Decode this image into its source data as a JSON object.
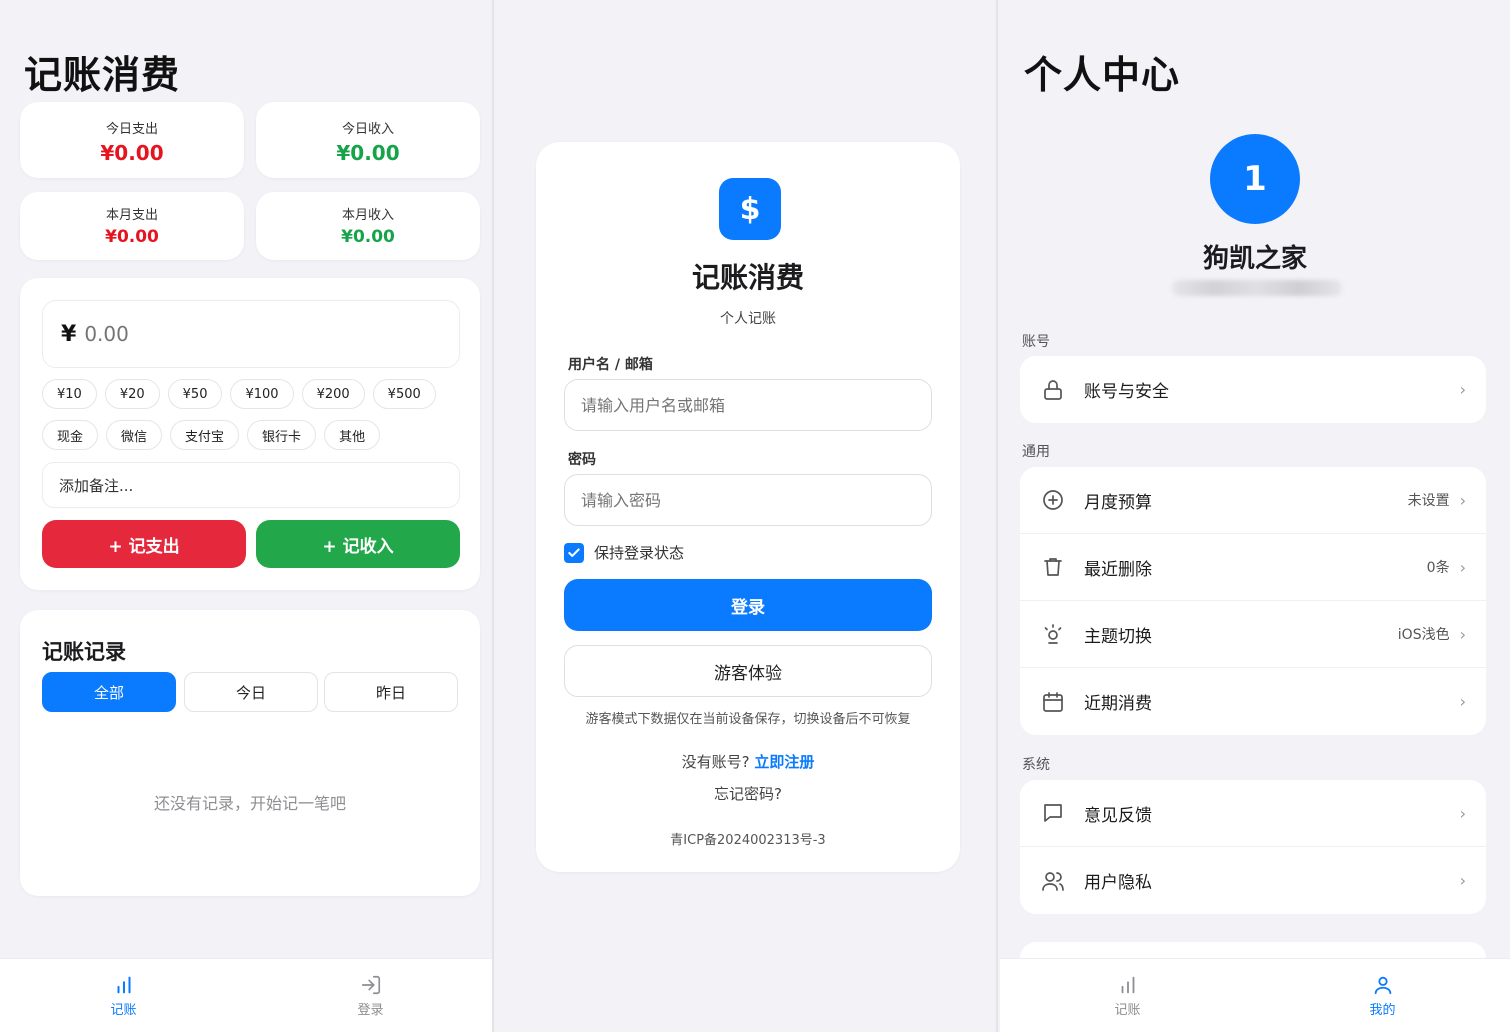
{
  "ledger": {
    "title": "记账消费",
    "stats": [
      {
        "label": "今日支出",
        "value": "¥0.00"
      },
      {
        "label": "今日收入",
        "value": "¥0.00"
      },
      {
        "label": "本月支出",
        "value": "¥0.00"
      },
      {
        "label": "本月收入",
        "value": "¥0.00"
      }
    ],
    "amount_symbol": "¥",
    "amount_placeholder": "0.00",
    "quick_amounts": [
      "¥10",
      "¥20",
      "¥50",
      "¥100",
      "¥200",
      "¥500"
    ],
    "payment_methods": [
      "现金",
      "微信",
      "支付宝",
      "银行卡",
      "其他"
    ],
    "note_placeholder": "添加备注...",
    "expense_button": "+ 记支出",
    "income_button": "+ 记收入",
    "records_title": "记账记录",
    "filters": [
      "全部",
      "今日",
      "昨日"
    ],
    "empty_text": "还没有记录，开始记一笔吧",
    "tabs": [
      {
        "label": "记账",
        "icon": "bar-chart-icon"
      },
      {
        "label": "登录",
        "icon": "login-icon"
      }
    ]
  },
  "login": {
    "logo_symbol": "$",
    "title": "记账消费",
    "subtitle": "个人记账",
    "username_label": "用户名 / 邮箱",
    "username_placeholder": "请输入用户名或邮箱",
    "password_label": "密码",
    "password_placeholder": "请输入密码",
    "remember_label": "保持登录状态",
    "remember_checked": true,
    "login_button": "登录",
    "guest_button": "游客体验",
    "guest_note": "游客模式下数据仅在当前设备保存，切换设备后不可恢复",
    "no_account": "没有账号?",
    "register_link": "立即注册",
    "forgot": "忘记密码?",
    "icp": "青ICP备2024002313号-3"
  },
  "profile": {
    "title": "个人中心",
    "avatar_text": "1",
    "username": "狗凯之家",
    "section_account": "账号",
    "account_items": [
      {
        "label": "账号与安全",
        "value": "",
        "icon": "lock-icon"
      }
    ],
    "section_general": "通用",
    "general_items": [
      {
        "label": "月度预算",
        "value": "未设置",
        "icon": "plus-circle-icon"
      },
      {
        "label": "最近删除",
        "value": "0条",
        "icon": "trash-icon"
      },
      {
        "label": "主题切换",
        "value": "iOS浅色",
        "icon": "sun-icon"
      },
      {
        "label": "近期消费",
        "value": "",
        "icon": "calendar-icon"
      }
    ],
    "section_system": "系统",
    "system_items": [
      {
        "label": "意见反馈",
        "value": "",
        "icon": "message-icon"
      },
      {
        "label": "用户隐私",
        "value": "",
        "icon": "users-icon"
      }
    ],
    "tabs": [
      {
        "label": "记账",
        "icon": "bar-chart-icon"
      },
      {
        "label": "我的",
        "icon": "user-icon"
      }
    ]
  },
  "colors": {
    "accent": "#0a7bff",
    "expense": "#e5141f",
    "income": "#16a34a",
    "background": "#f2f2f7"
  }
}
